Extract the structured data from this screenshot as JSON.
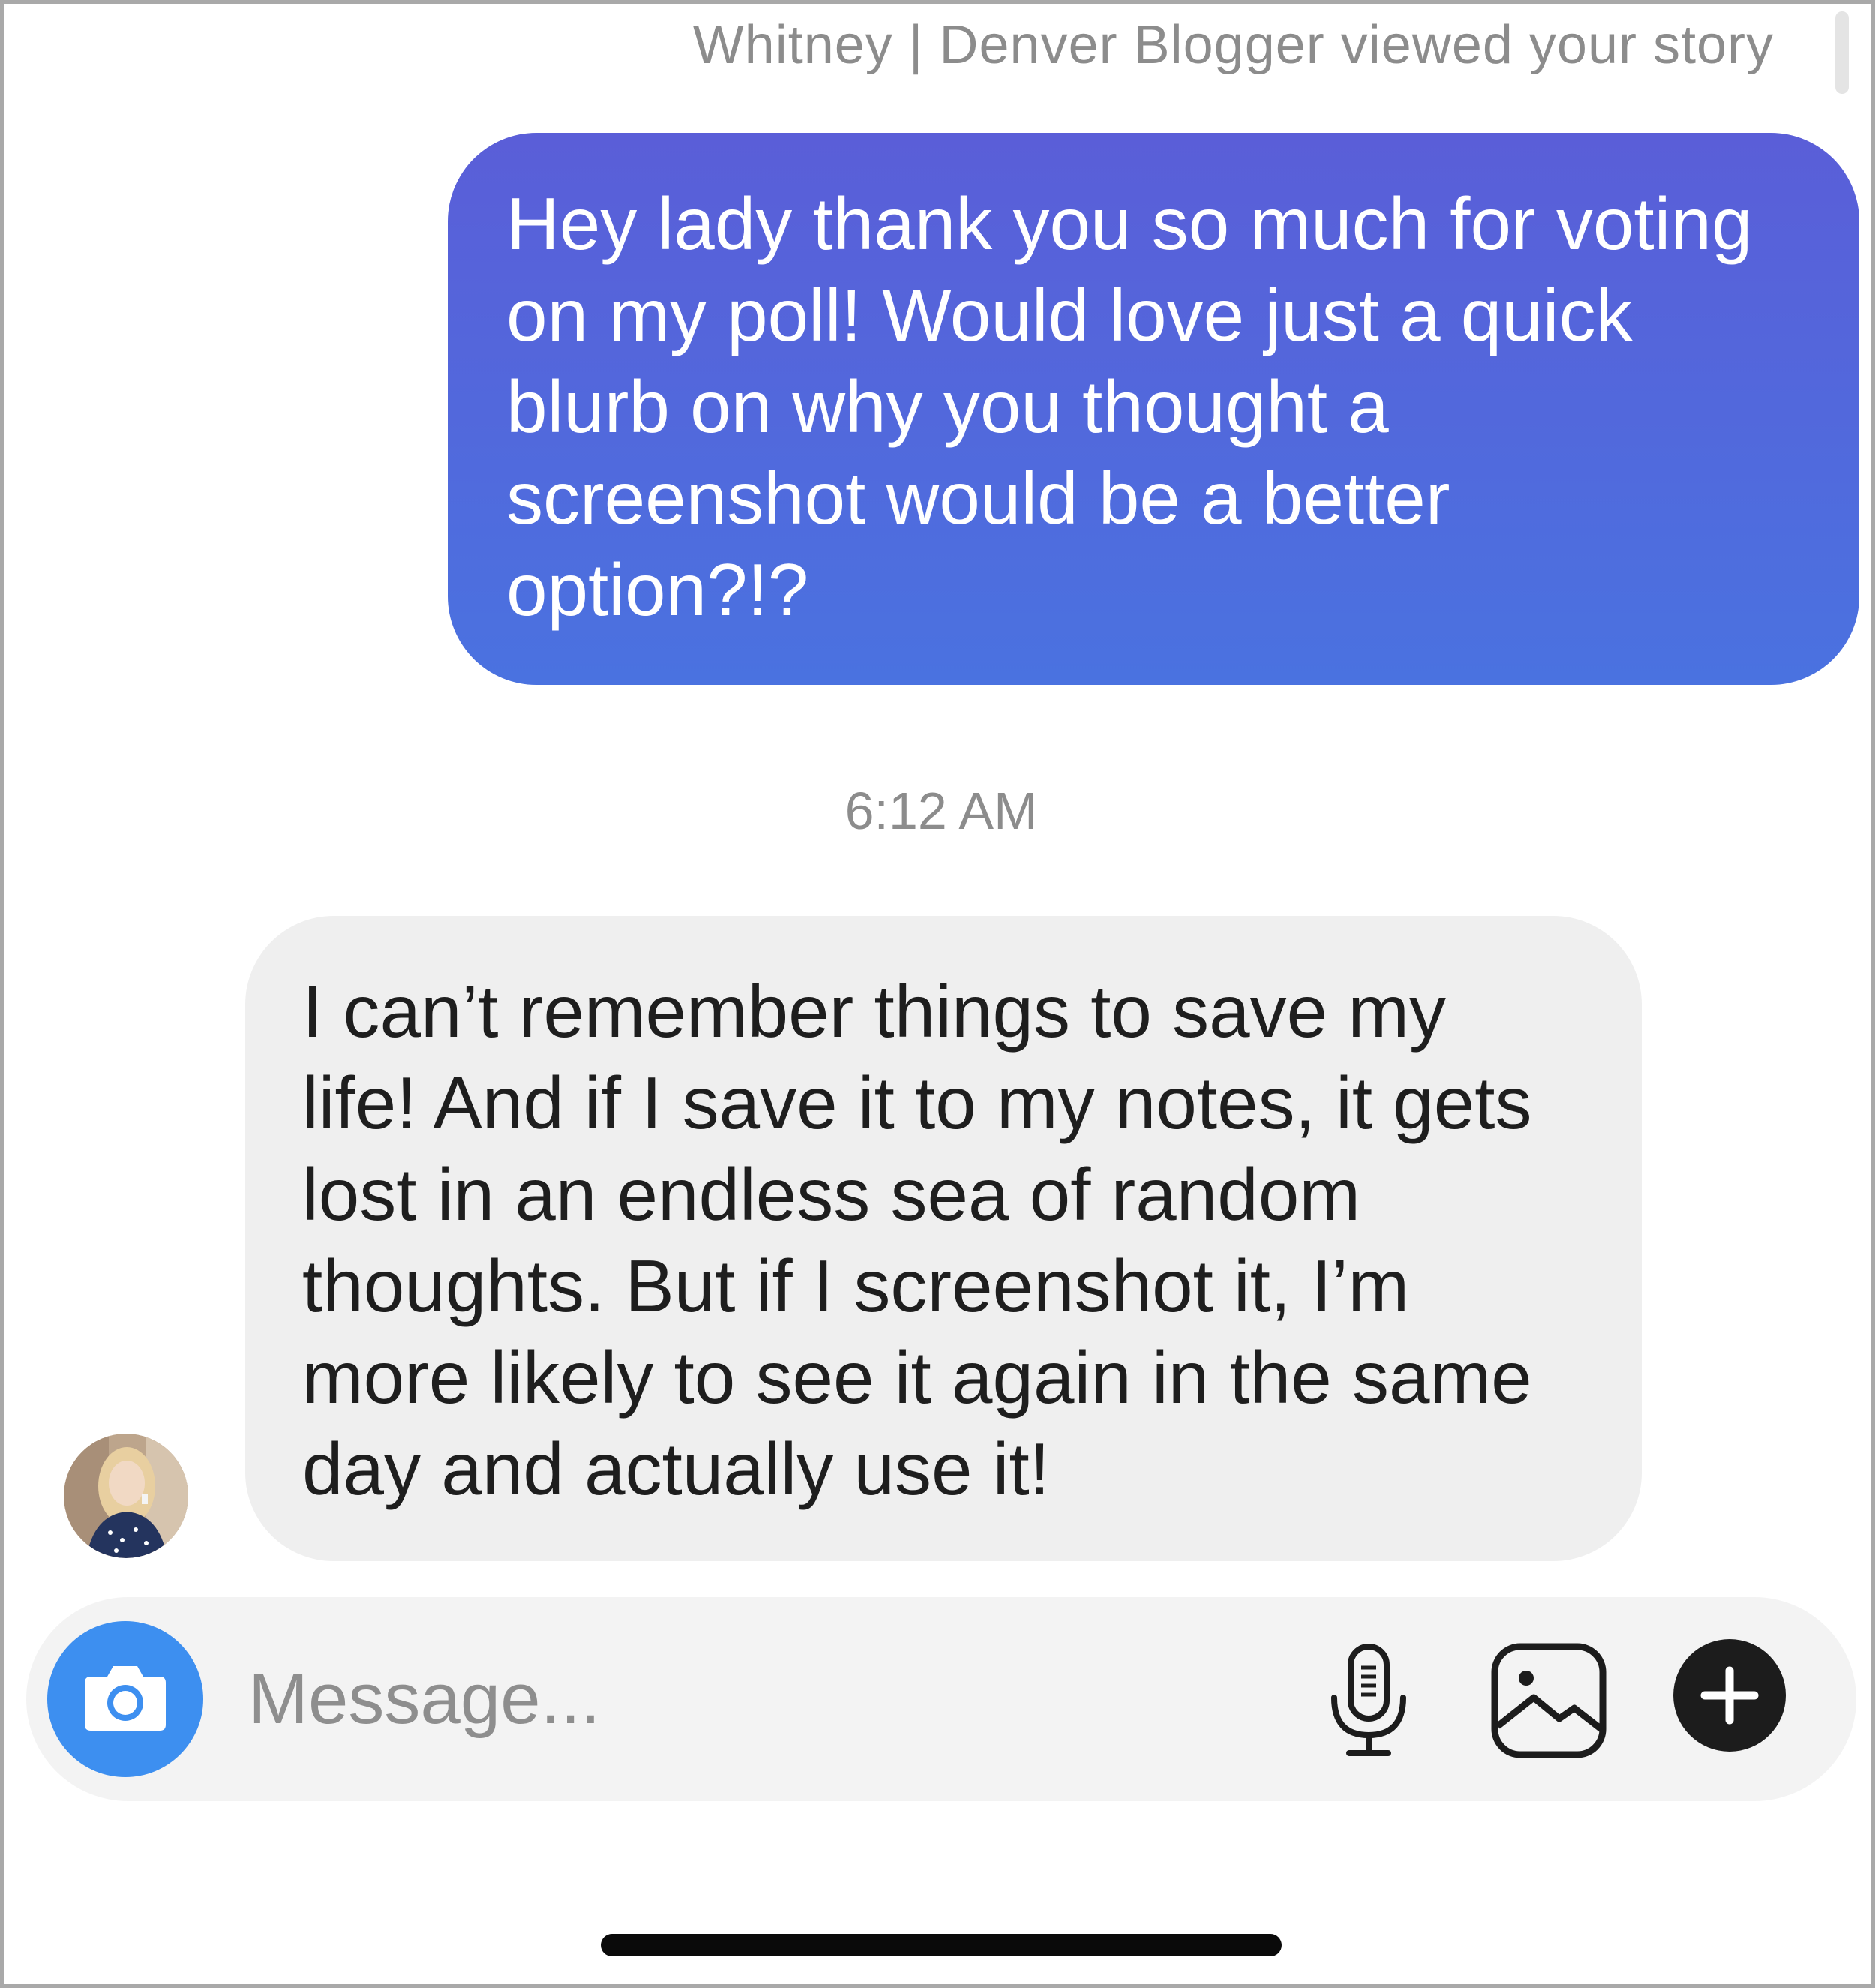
{
  "thread": {
    "story_notice": "Whitney | Denver Blogger viewed your story",
    "messages": [
      {
        "sender": "me",
        "lines": [
          "Hey lady thank you so much for voting",
          "on my poll! Would love just a quick",
          "blurb on why you thought a",
          "screenshot would be a better",
          "option?!?"
        ]
      },
      {
        "sender": "them",
        "lines": [
          "I can’t remember things to save my",
          "life! And if I save it to my notes, it gets",
          "lost in an endless sea of random",
          "thoughts. But if I screenshot it, I’m",
          "more likely to see it again in the same",
          "day and actually use it!"
        ]
      }
    ],
    "timestamp": "6:12 AM"
  },
  "composer": {
    "placeholder": "Message...",
    "icons": {
      "camera": "camera-icon",
      "mic": "microphone-icon",
      "gallery": "gallery-icon",
      "plus": "plus-icon"
    }
  },
  "colors": {
    "outgoing_bubble_top": "#5a5ed8",
    "outgoing_bubble_bottom": "#4a72e0",
    "incoming_bubble": "#efefef",
    "camera_button": "#3d8ff0",
    "secondary_text": "#8c8c8c"
  }
}
